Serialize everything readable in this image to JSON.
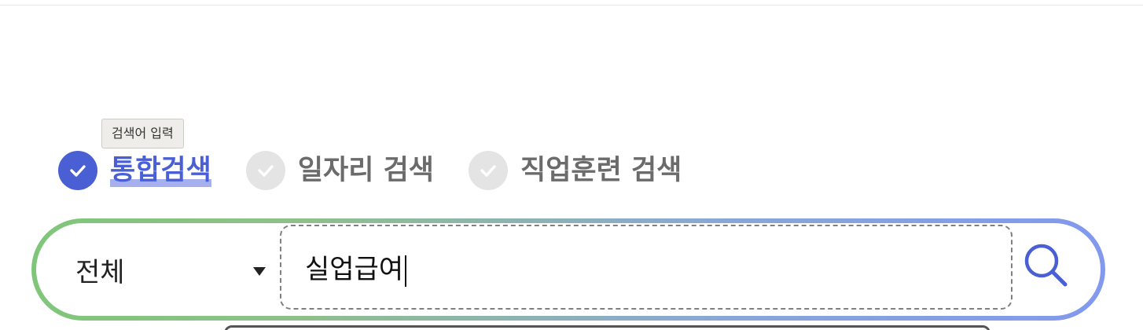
{
  "tooltip": {
    "text": "검색어 입력"
  },
  "tabs": [
    {
      "label": "통합검색",
      "checked": true,
      "icon": "check-icon"
    },
    {
      "label": "일자리 검색",
      "checked": false,
      "icon": "check-icon"
    },
    {
      "label": "직업훈련 검색",
      "checked": false,
      "icon": "check-icon"
    }
  ],
  "search": {
    "category": "전체",
    "query": "실업급여",
    "search_icon": "search-icon"
  },
  "colors": {
    "accent": "#4a5fd4",
    "inactive_check": "#e4e4e4",
    "gradient_start": "#7fc67a",
    "gradient_end": "#8299ee"
  }
}
